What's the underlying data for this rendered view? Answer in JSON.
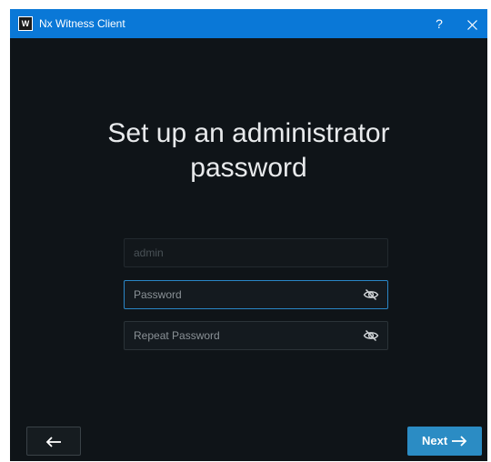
{
  "titlebar": {
    "app_icon_text": "W",
    "title": "Nx Witness Client",
    "help_label": "?",
    "close_icon": "close-icon"
  },
  "main": {
    "heading_line1": "Set up an administrator",
    "heading_line2": "password"
  },
  "form": {
    "username_placeholder": "admin",
    "password_placeholder": "Password",
    "repeat_password_placeholder": "Repeat Password",
    "visibility_icon": "eye-crossed-icon"
  },
  "footer": {
    "back_icon": "arrow-left-icon",
    "next_label": "Next",
    "next_icon": "arrow-right-icon"
  },
  "colors": {
    "titlebar": "#0a78d7",
    "background": "#0f1418",
    "accent": "#2b8cc4",
    "focus_border": "#2a86c6"
  }
}
